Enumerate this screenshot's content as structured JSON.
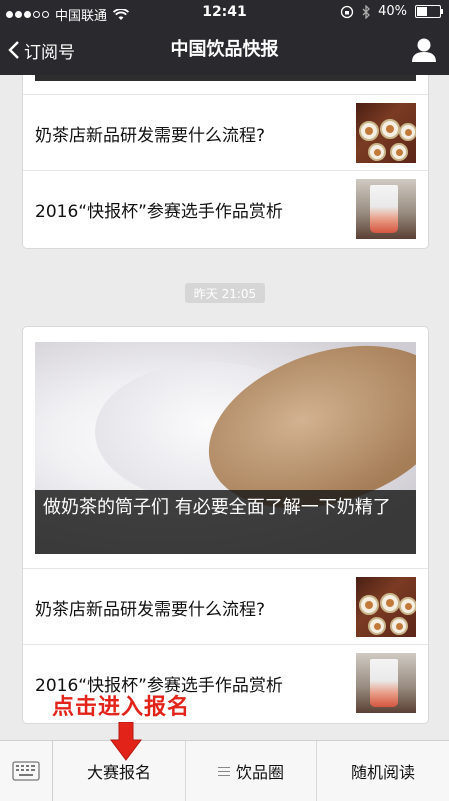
{
  "status_bar": {
    "carrier": "中国联通",
    "time": "12:41",
    "battery": "40%",
    "signal_strength": 3,
    "signal_max": 5,
    "battery_level": 0.4
  },
  "nav": {
    "back_label": "订阅号",
    "title": "中国饮品快报",
    "profile_icon": "person-icon"
  },
  "messages": [
    {
      "items": [
        {
          "title": "奶茶店新品研发需要什么流程?",
          "thumb": "cups-image"
        },
        {
          "title": "2016“快报杯”参赛选手作品赏析",
          "thumb": "drink-image"
        }
      ]
    },
    {
      "timestamp": "昨天 21:05",
      "cover_title": "做奶茶的筒子们 有必要全面了解一下奶精了",
      "items": [
        {
          "title": "奶茶店新品研发需要什么流程?",
          "thumb": "cups-image"
        },
        {
          "title": "2016“快报杯”参赛选手作品赏析",
          "thumb": "drink-image"
        }
      ]
    }
  ],
  "overlay": {
    "annotation": "点击进入报名",
    "color": "#e2231a"
  },
  "menu": {
    "keyboard_icon": "keyboard-icon",
    "tabs": [
      {
        "label": "大赛报名"
      },
      {
        "label": "饮品圈",
        "icon": "menu-lines-icon"
      },
      {
        "label": "随机阅读"
      }
    ]
  }
}
